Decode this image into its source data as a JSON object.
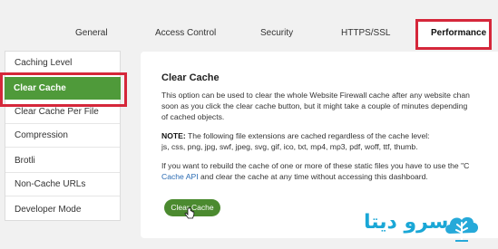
{
  "tabs": {
    "general": "General",
    "access_control": "Access Control",
    "security": "Security",
    "https_ssl": "HTTPS/SSL",
    "performance": "Performance"
  },
  "sidebar": {
    "items": [
      {
        "label": "Caching Level"
      },
      {
        "label": "Clear Cache"
      },
      {
        "label": "Clear Cache Per File"
      },
      {
        "label": "Compression"
      },
      {
        "label": "Brotli"
      },
      {
        "label": "Non-Cache URLs"
      },
      {
        "label": "Developer Mode"
      }
    ],
    "active": "Clear Cache"
  },
  "main": {
    "title": "Clear Cache",
    "paragraph1_line1": "This option can be used to clear the whole Website Firewall cache after any website chan",
    "paragraph1_line2": "soon as you click the clear cache button, but it might take a couple of minutes depending",
    "paragraph1_line3": "of cached objects.",
    "note_label": "NOTE:",
    "note_text": " The following file extensions are cached regardless of the cache level:",
    "extensions": "js, css, png, jpg, swf, jpeg, svg, gif, ico, txt, mp4, mp3, pdf, woff, ttf, thumb.",
    "paragraph3_line1": "If you want to rebuild the cache of one or more of these static files you have to use the \"C",
    "link_text": "Cache API",
    "paragraph3_line2_rest": " and clear the cache at any time without accessing this dashboard.",
    "button_label": "Clear Cache"
  },
  "watermark": {
    "text": "سرو دیتا",
    "icon": "tree-cloud-logo-icon"
  },
  "colors": {
    "accent_green": "#4f9a3a",
    "button_green": "#4b8a2f",
    "highlight_red": "#d5273a",
    "link_blue": "#2a6bb3",
    "logo_blue": "#1aa7d6"
  }
}
